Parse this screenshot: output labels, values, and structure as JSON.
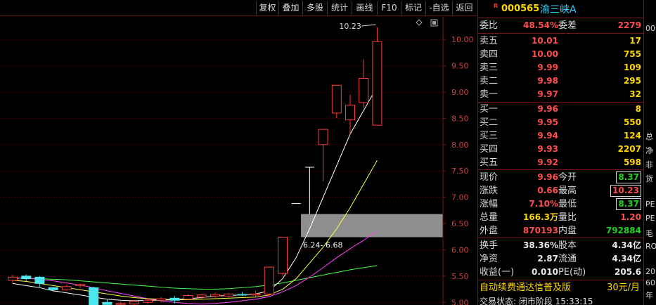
{
  "toolbar": {
    "buttons": [
      "复权",
      "叠加",
      "多股",
      "统计",
      "画线",
      "F10",
      "标记",
      "-自选",
      "返回"
    ]
  },
  "chart": {
    "high_marker": "10.23",
    "range_label": "6.24- 6.68",
    "price_ticks": [
      "10.00",
      "9.50",
      "9.00",
      "8.50",
      "8.00",
      "7.50",
      "7.00",
      "6.50",
      "6.00",
      "5.50",
      "5.00"
    ],
    "colors": {
      "up": "#ff3b3b",
      "down": "#4ee6ee",
      "ma5": "#ffffff",
      "ma10": "#ffff44",
      "ma20": "#ff44ff",
      "ma60": "#44ff44"
    }
  },
  "chart_data": {
    "type": "candlestick",
    "ylim": [
      4.95,
      10.35
    ],
    "ticks": [
      10.0,
      9.5,
      9.0,
      8.5,
      8.0,
      7.5,
      7.0,
      6.5,
      6.0,
      5.5,
      5.0
    ],
    "candles": [
      {
        "o": 5.42,
        "c": 5.48,
        "h": 5.52,
        "l": 5.38
      },
      {
        "o": 5.5,
        "c": 5.45,
        "h": 5.53,
        "l": 5.4
      },
      {
        "o": 5.48,
        "c": 5.36,
        "h": 5.5,
        "l": 5.3
      },
      {
        "o": 5.28,
        "c": 5.24,
        "h": 5.3,
        "l": 5.2
      },
      {
        "o": 5.24,
        "c": 5.3,
        "h": 5.34,
        "l": 5.22
      },
      {
        "o": 5.32,
        "c": 5.34,
        "h": 5.36,
        "l": 5.28
      },
      {
        "o": 5.28,
        "c": 4.95,
        "h": 5.3,
        "l": 4.9
      },
      {
        "o": 5.0,
        "c": 4.96,
        "h": 5.05,
        "l": 4.9
      },
      {
        "o": 4.96,
        "c": 4.98,
        "h": 5.02,
        "l": 4.9
      },
      {
        "o": 4.97,
        "c": 5.02,
        "h": 5.05,
        "l": 4.93
      },
      {
        "o": 5.0,
        "c": 5.04,
        "h": 5.07,
        "l": 4.97
      },
      {
        "o": 5.04,
        "c": 5.07,
        "h": 5.1,
        "l": 5.0
      },
      {
        "o": 5.08,
        "c": 5.04,
        "h": 5.12,
        "l": 4.98
      },
      {
        "o": 5.06,
        "c": 5.13,
        "h": 5.16,
        "l": 5.04
      },
      {
        "o": 5.1,
        "c": 5.14,
        "h": 5.16,
        "l": 5.07
      },
      {
        "o": 5.12,
        "c": 5.15,
        "h": 5.18,
        "l": 5.09
      },
      {
        "o": 5.12,
        "c": 5.16,
        "h": 5.18,
        "l": 5.1
      },
      {
        "o": 5.15,
        "c": 5.14,
        "h": 5.2,
        "l": 5.12
      },
      {
        "o": 5.14,
        "c": 5.16,
        "h": 5.22,
        "l": 5.1
      },
      {
        "o": 5.16,
        "c": 5.67,
        "h": 5.68,
        "l": 5.12
      },
      {
        "o": 5.55,
        "c": 6.24,
        "h": 6.24,
        "l": 5.5
      },
      {
        "o": 6.88,
        "c": 6.88,
        "h": 6.88,
        "l": 6.88
      },
      {
        "o": 7.57,
        "c": 7.57,
        "h": 7.57,
        "l": 6.68
      },
      {
        "o": 8.0,
        "c": 8.29,
        "h": 8.29,
        "l": 7.3
      },
      {
        "o": 8.6,
        "c": 9.13,
        "h": 9.13,
        "l": 8.5
      },
      {
        "o": 8.47,
        "c": 8.75,
        "h": 8.95,
        "l": 8.2
      },
      {
        "o": 8.8,
        "c": 9.26,
        "h": 9.62,
        "l": 8.7
      },
      {
        "o": 8.37,
        "c": 9.96,
        "h": 10.23,
        "l": 8.37
      }
    ],
    "ma5": [
      5.36,
      5.32,
      5.28,
      5.22,
      5.18,
      5.14,
      5.1,
      5.06,
      5.04,
      5.03,
      5.04,
      5.04,
      5.05,
      5.07,
      5.09,
      5.12,
      5.13,
      5.14,
      5.16,
      5.22,
      5.45,
      5.85,
      6.4,
      7.0,
      7.6,
      8.2,
      8.65,
      9.1
    ],
    "ma10": [
      5.42,
      5.4,
      5.36,
      5.32,
      5.28,
      5.24,
      5.2,
      5.16,
      5.12,
      5.09,
      5.07,
      5.06,
      5.05,
      5.05,
      5.06,
      5.07,
      5.08,
      5.09,
      5.1,
      5.14,
      5.25,
      5.45,
      5.75,
      6.05,
      6.4,
      6.8,
      7.25,
      7.7
    ],
    "ma20": [
      5.47,
      5.46,
      5.44,
      5.41,
      5.37,
      5.33,
      5.28,
      5.22,
      5.17,
      5.12,
      5.07,
      5.03,
      5.0,
      4.98,
      4.97,
      4.98,
      5.0,
      5.03,
      5.06,
      5.11,
      5.2,
      5.32,
      5.48,
      5.66,
      5.85,
      6.02,
      6.18,
      6.36
    ],
    "ma60": [
      5.46,
      5.46,
      5.45,
      5.44,
      5.43,
      5.41,
      5.39,
      5.37,
      5.35,
      5.33,
      5.31,
      5.29,
      5.27,
      5.26,
      5.25,
      5.25,
      5.26,
      5.28,
      5.3,
      5.33,
      5.37,
      5.42,
      5.47,
      5.52,
      5.57,
      5.62,
      5.66,
      5.7
    ],
    "band": [
      6.24,
      6.68
    ]
  },
  "quote": {
    "r_mark": "R",
    "code": "000565",
    "name": "渝三峡A",
    "weibi_label": "委比",
    "weibi": "48.54%",
    "weicha_label": "委差",
    "weicha": "2279",
    "asks": [
      {
        "label": "卖五",
        "price": "10.01",
        "vol": "17"
      },
      {
        "label": "卖四",
        "price": "10.00",
        "vol": "755"
      },
      {
        "label": "卖三",
        "price": "9.99",
        "vol": "109"
      },
      {
        "label": "卖二",
        "price": "9.98",
        "vol": "295"
      },
      {
        "label": "卖一",
        "price": "9.97",
        "vol": "32"
      }
    ],
    "bids": [
      {
        "label": "买一",
        "price": "9.96",
        "vol": "8"
      },
      {
        "label": "买二",
        "price": "9.95",
        "vol": "550"
      },
      {
        "label": "买三",
        "price": "9.94",
        "vol": "124"
      },
      {
        "label": "买四",
        "price": "9.93",
        "vol": "2207"
      },
      {
        "label": "买五",
        "price": "9.92",
        "vol": "598"
      }
    ],
    "stats": [
      {
        "l1": "现价",
        "v1": "9.96",
        "l2": "今开",
        "v2": "8.37"
      },
      {
        "l1": "涨跌",
        "v1": "0.66",
        "l2": "最高",
        "v2": "10.23"
      },
      {
        "l1": "涨幅",
        "v1": "7.10%",
        "l2": "最低",
        "v2": "8.37"
      },
      {
        "l1": "总量",
        "v1": "166.3万",
        "l2": "量比",
        "v2": "1.20"
      },
      {
        "l1": "外盘",
        "v1": "870193",
        "l2": "内盘",
        "v2": "792884"
      }
    ],
    "fund": [
      {
        "l1": "换手",
        "v1": "38.36%",
        "l2": "股本",
        "v2": "4.34亿"
      },
      {
        "l1": "净资",
        "v1": "2.87",
        "l2": "流通",
        "v2": "4.34亿"
      },
      {
        "l1": "收益(一)",
        "v1": "0.010",
        "l2": "PE(动)",
        "v2": "205.6"
      }
    ],
    "promo": "自动续费通达信普及版",
    "promo_price": "30元/月",
    "status": "交易状态: 闭市阶段 15:33:15"
  },
  "edge": [
    "00",
    "总",
    "净",
    "非",
    "货",
    "PE",
    "PE",
    "毛",
    "RO",
    "20",
    "60",
    "年"
  ]
}
